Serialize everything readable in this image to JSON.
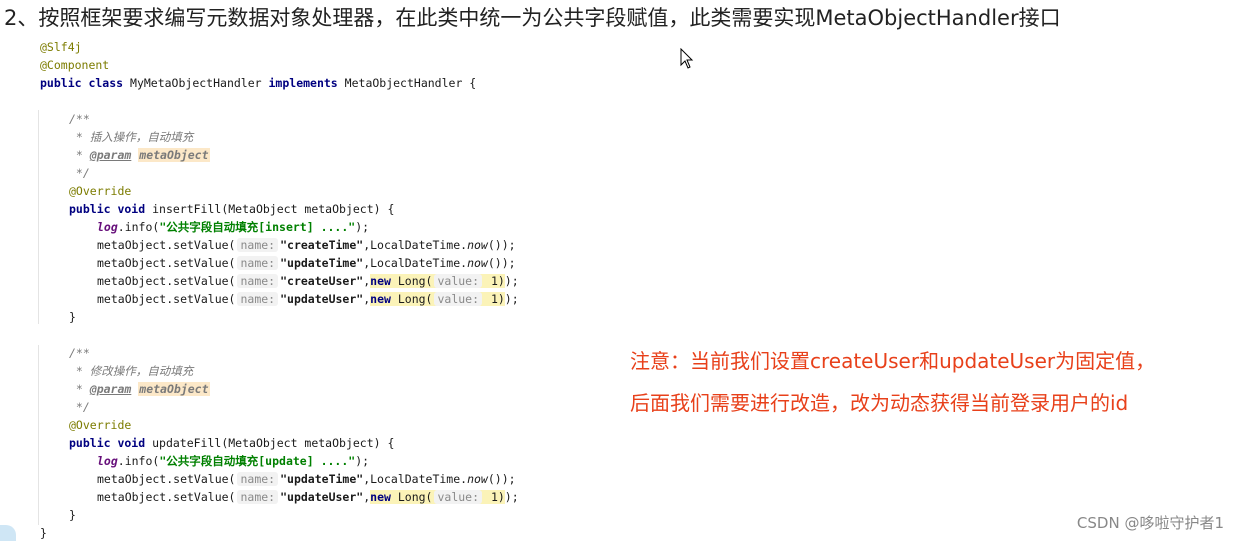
{
  "heading": "2、按照框架要求编写元数据对象处理器，在此类中统一为公共字段赋值，此类需要实现MetaObjectHandler接口",
  "code": {
    "annotations": [
      "@Slf4j",
      "@Component"
    ],
    "class_decl": {
      "kw1": "public class",
      "name": " MyMetaObjectHandler ",
      "kw2": "implements",
      "iface": " MetaObjectHandler {"
    },
    "insert": {
      "doc_open": "/**",
      "doc_desc": " * 插入操作，自动填充",
      "doc_param_prefix": " * ",
      "doc_param_tag": "@param",
      "doc_param_name": "metaObject",
      "doc_close": " */",
      "override": "@Override",
      "sig_kw": "public void",
      "sig_rest": " insertFill(MetaObject metaObject) {",
      "log_name": "log",
      "log_call": ".info(",
      "log_msg": "\"公共字段自动填充[insert] ....\"",
      "log_end": ");",
      "set_prefix": "metaObject.setValue(",
      "name_hint": "name:",
      "rows": [
        {
          "field": "\"createTime\"",
          "rest1": ",LocalDateTime.",
          "now": "now",
          "rest2": "());"
        },
        {
          "field": "\"updateTime\"",
          "rest1": ",LocalDateTime.",
          "now": "now",
          "rest2": "());"
        }
      ],
      "rows_long": [
        {
          "field": "\"createUser\"",
          "new_kw": "new",
          "long": " Long(",
          "value_hint": "value:",
          "value": " 1)",
          "end": ");"
        },
        {
          "field": "\"updateUser\"",
          "new_kw": "new",
          "long": " Long(",
          "value_hint": "value:",
          "value": " 1)",
          "end": ");"
        }
      ],
      "close": "}"
    },
    "update": {
      "doc_open": "/**",
      "doc_desc": " * 修改操作，自动填充",
      "doc_param_prefix": " * ",
      "doc_param_tag": "@param",
      "doc_param_name": "metaObject",
      "doc_close": " */",
      "override": "@Override",
      "sig_kw": "public void",
      "sig_rest": " updateFill(MetaObject metaObject) {",
      "log_name": "log",
      "log_call": ".info(",
      "log_msg": "\"公共字段自动填充[update] ....\"",
      "log_end": ");",
      "rows": [
        {
          "field": "\"updateTime\"",
          "rest1": ",LocalDateTime.",
          "now": "now",
          "rest2": "());"
        }
      ],
      "rows_long": [
        {
          "field": "\"updateUser\"",
          "new_kw": "new",
          "long": " Long(",
          "value_hint": "value:",
          "value": " 1)",
          "end": ");"
        }
      ],
      "close": "}"
    },
    "class_close": "}"
  },
  "note": {
    "line1": "注意：当前我们设置createUser和updateUser为固定值，",
    "line2": "后面我们需要进行改造，改为动态获得当前登录用户的id"
  },
  "watermark": "CSDN @哆啦守护者1",
  "colors": {
    "note": "#e8401a",
    "keyword": "#000080",
    "string": "#008000",
    "annotation": "#7c7c00",
    "highlight": "#fce8c8"
  },
  "icons": [
    "mouse-cursor-icon"
  ]
}
